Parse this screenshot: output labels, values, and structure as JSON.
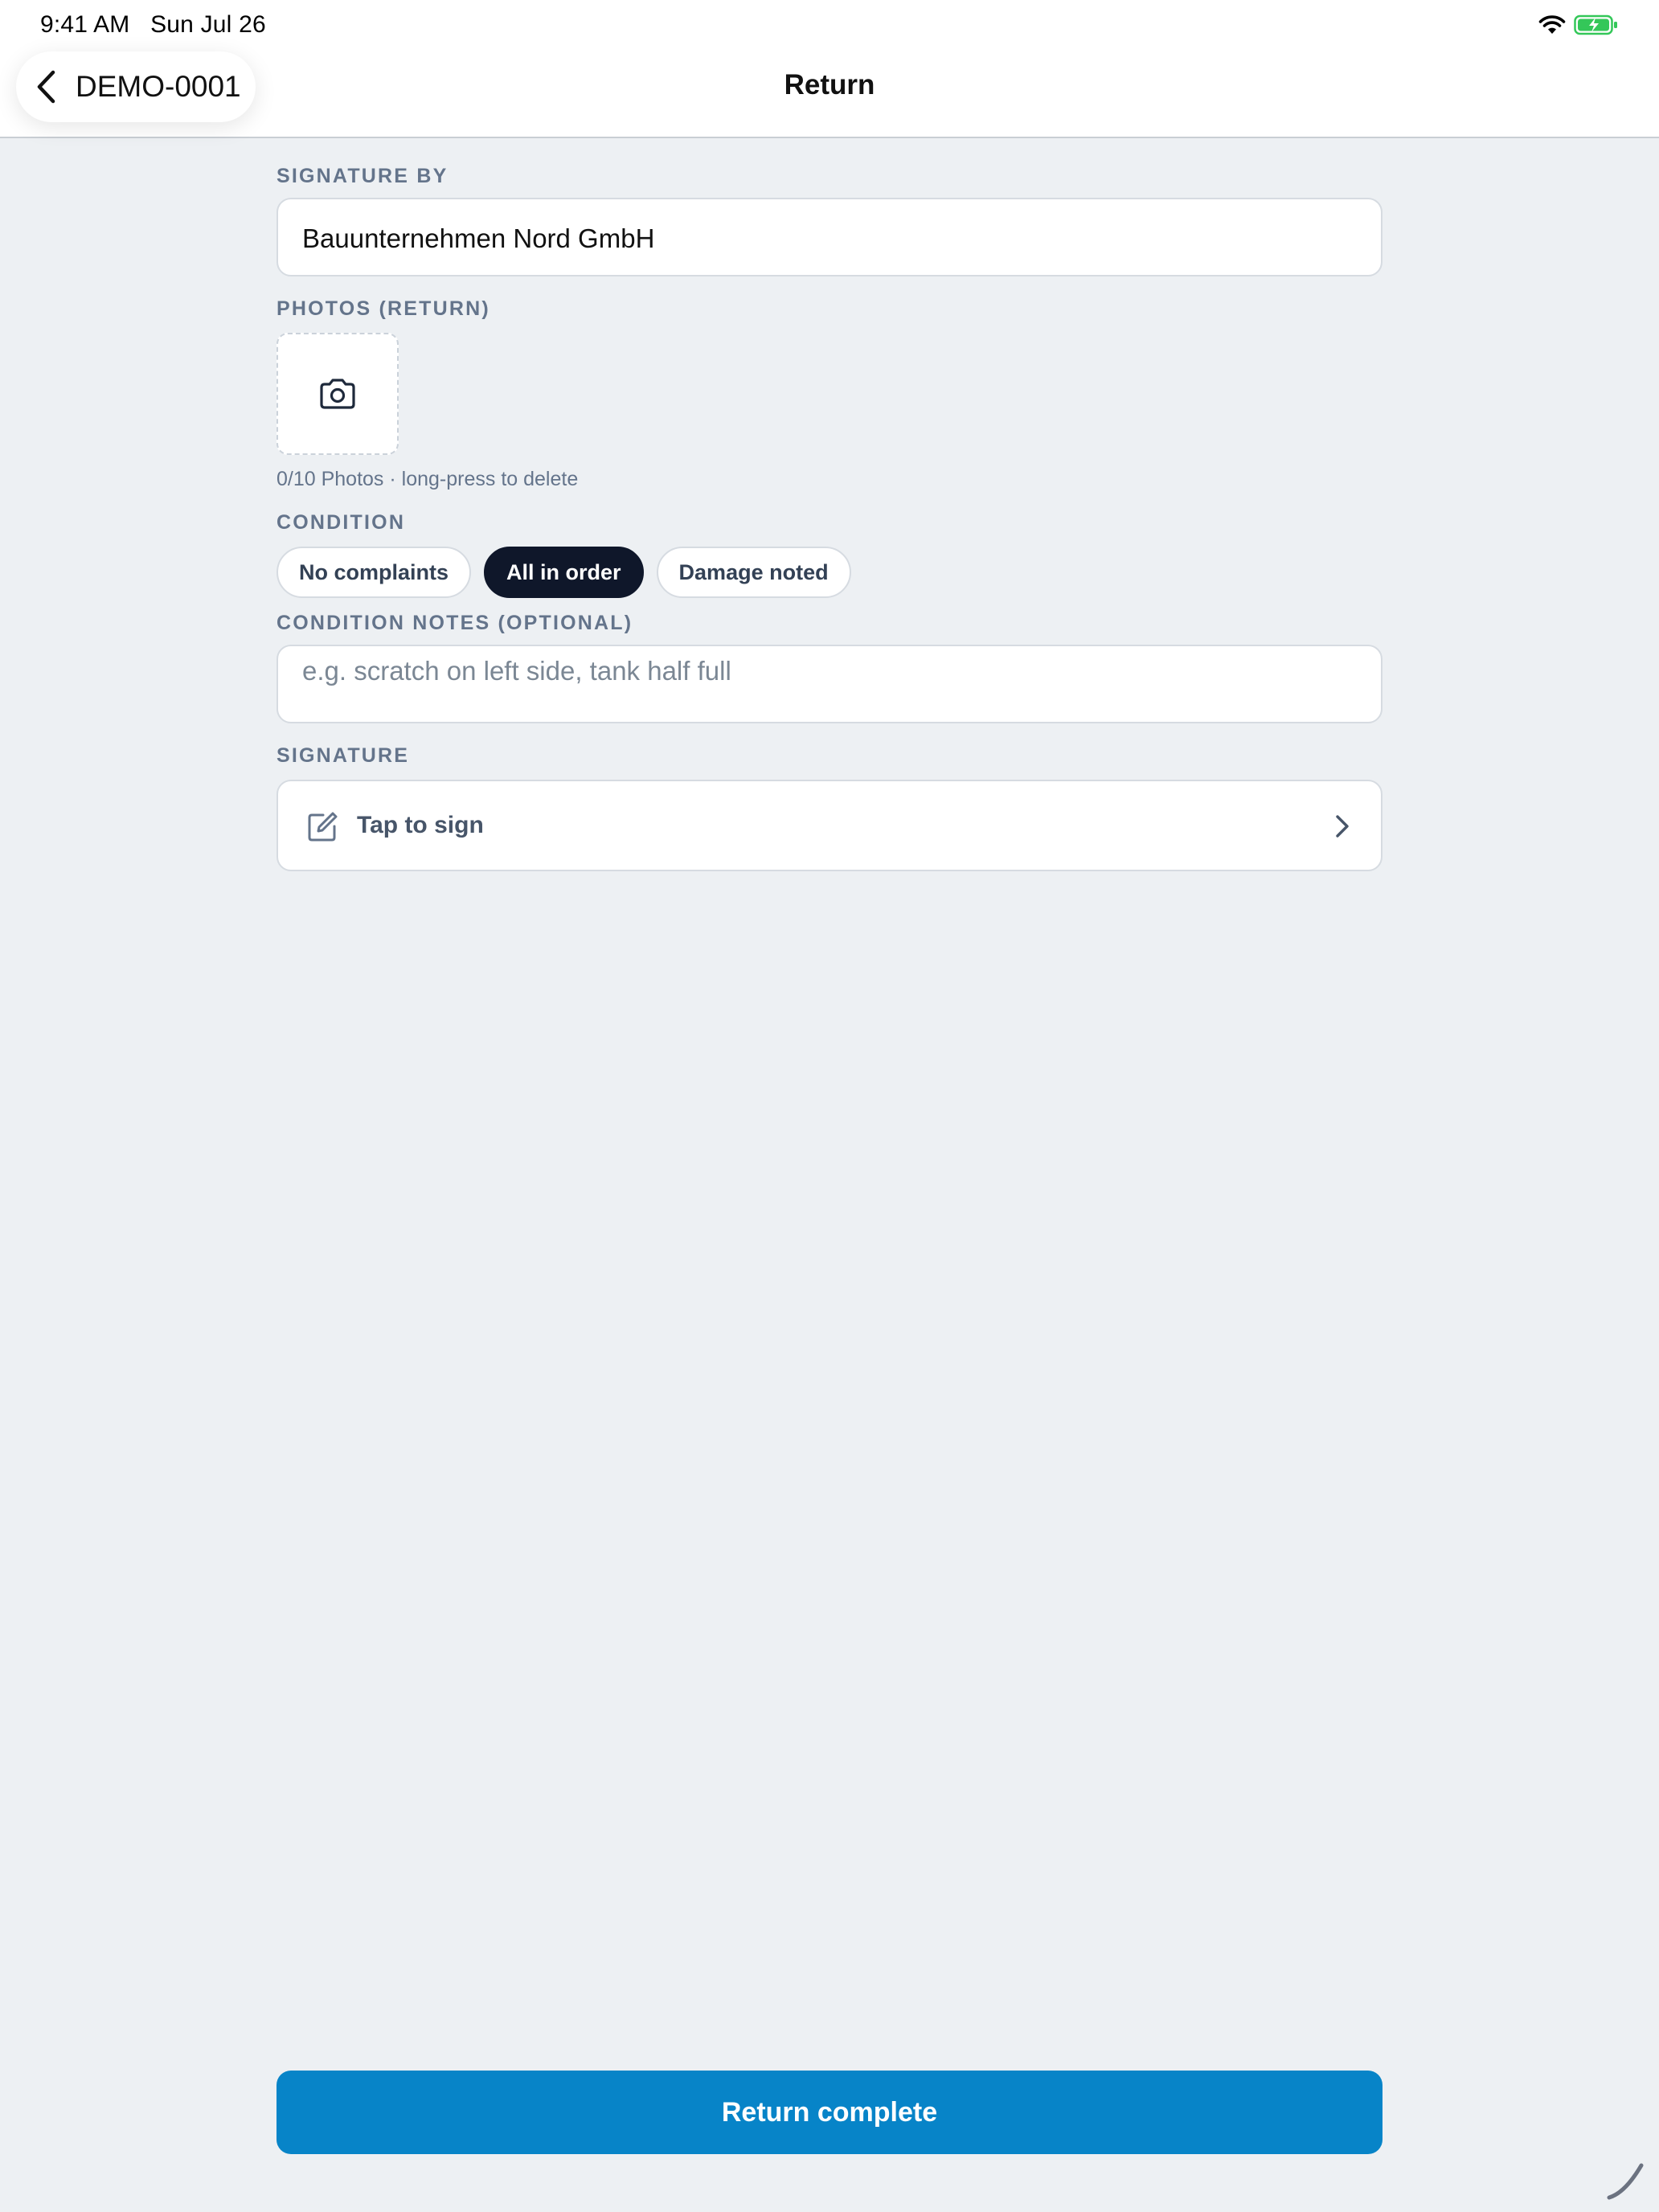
{
  "status_bar": {
    "time": "9:41 AM",
    "date": "Sun Jul 26",
    "icons": [
      "wifi-icon",
      "battery-charging-icon"
    ]
  },
  "nav": {
    "back_label": "DEMO-0001",
    "title": "Return"
  },
  "form": {
    "signature_by": {
      "label": "SIGNATURE BY",
      "value": "Bauunternehmen Nord GmbH"
    },
    "photos": {
      "label": "PHOTOS (RETURN)",
      "hint": "0/10 Photos · long-press to delete",
      "count": 0,
      "max": 10
    },
    "condition": {
      "label": "CONDITION",
      "options": [
        "No complaints",
        "All in order",
        "Damage noted"
      ],
      "selected": "All in order"
    },
    "condition_notes": {
      "label": "CONDITION NOTES (OPTIONAL)",
      "value": "",
      "placeholder": "e.g. scratch on left side, tank half full"
    },
    "signature": {
      "label": "SIGNATURE",
      "action_label": "Tap to sign"
    }
  },
  "actions": {
    "submit_label": "Return complete"
  },
  "colors": {
    "primary": "#0784c8",
    "chip_selected": "#0f172a",
    "background": "#edf0f3",
    "label": "#64748b",
    "battery": "#34c759"
  }
}
